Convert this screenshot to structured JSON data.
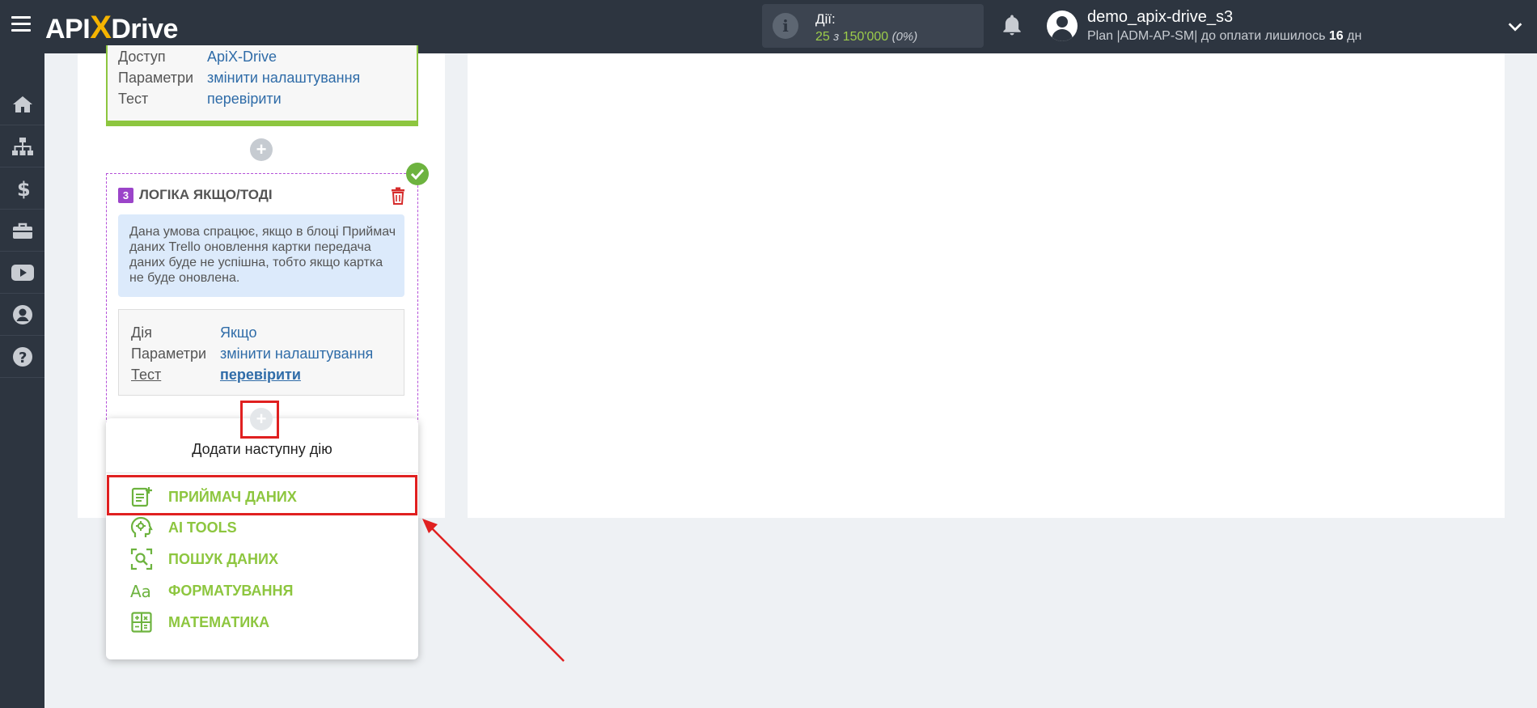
{
  "header": {
    "logo_api": "API",
    "logo_x": "X",
    "logo_drive": "Drive",
    "actions_label": "Дії:",
    "actions_used": "25",
    "actions_of": "з",
    "actions_total": "150'000",
    "actions_percent": "(0%)",
    "username": "demo_apix-drive_s3",
    "plan_text": "Plan |ADM-AP-SM| до оплати лишилось",
    "plan_days": "16",
    "plan_days_unit": "дн"
  },
  "sidebar": {
    "items": [
      "home-icon",
      "sitemap-icon",
      "dollar-icon",
      "briefcase-icon",
      "youtube-icon",
      "user-icon",
      "help-icon"
    ]
  },
  "block1": {
    "rows": [
      {
        "key": "Доступ",
        "value": "ApiX-Drive"
      },
      {
        "key": "Параметри",
        "value": "змінити налаштування"
      },
      {
        "key": "Тест",
        "value": "перевірити"
      }
    ]
  },
  "block3": {
    "number": "3",
    "title": "ЛОГІКА ЯКЩО/ТОДІ",
    "info": "Дана умова спрацює, якщо в блоці Приймач даних Trello оновлення картки передача даних буде не успішна, тобто якщо картка не буде оновлена.",
    "rows": [
      {
        "key": "Дія",
        "value": "Якщо"
      },
      {
        "key": "Параметри",
        "value": "змінити налаштування"
      },
      {
        "key": "Тест",
        "value": "перевірити"
      }
    ]
  },
  "plus": "+",
  "dropdown": {
    "title": "Додати наступну дію",
    "items": [
      {
        "label": "ПРИЙМАЧ ДАНИХ",
        "icon": "document-plus-icon"
      },
      {
        "label": "AI TOOLS",
        "icon": "ai-head-icon"
      },
      {
        "label": "ПОШУК ДАНИХ",
        "icon": "search-frame-icon"
      },
      {
        "label": "ФОРМАТУВАННЯ",
        "icon": "text-format-icon"
      },
      {
        "label": "МАТЕМАТИКА",
        "icon": "calculator-icon"
      }
    ]
  },
  "colors": {
    "topbar": "#2d3540",
    "green": "#8dc63f",
    "purple": "#9b44c9",
    "link": "#2f6ca8",
    "highlight_red": "#e02020"
  }
}
